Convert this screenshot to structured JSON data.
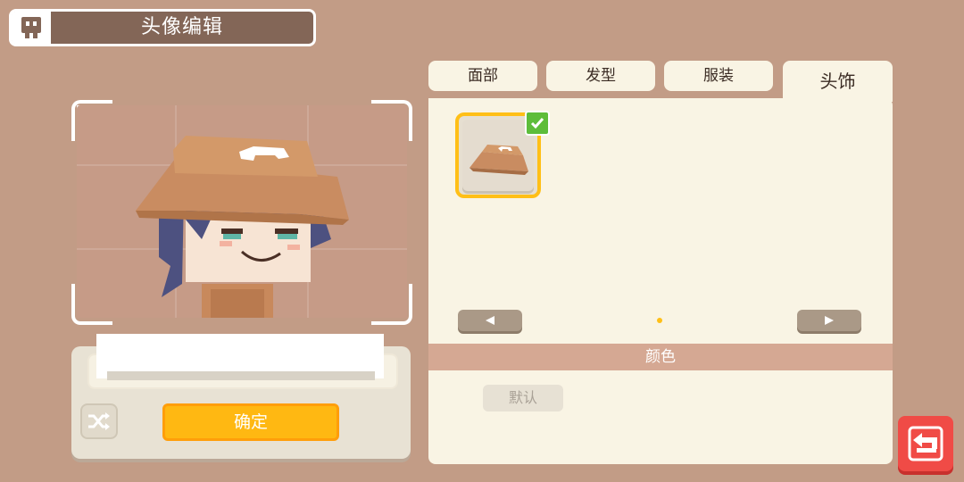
{
  "header": {
    "title": "头像编辑",
    "icon": "avatar-face-icon"
  },
  "tabs": [
    {
      "label": "面部",
      "active": false
    },
    {
      "label": "发型",
      "active": false
    },
    {
      "label": "服装",
      "active": false
    },
    {
      "label": "头饰",
      "active": true
    }
  ],
  "items": [
    {
      "name": "bucket-hat",
      "selected": true,
      "icon": "hat-icon"
    }
  ],
  "pagination": {
    "current_page": 1,
    "total_pages": 1
  },
  "color_section": {
    "title": "颜色",
    "default_label": "默认"
  },
  "name_panel": {
    "name_value": "",
    "confirm_label": "确定",
    "shuffle_icon": "shuffle-icon"
  },
  "colors": {
    "background": "#c29c86",
    "accent": "#ffb812",
    "selected_border": "#ffbf17",
    "check": "#5dbd3b",
    "back_button": "#f04b46",
    "panel": "#f9f4e4"
  }
}
